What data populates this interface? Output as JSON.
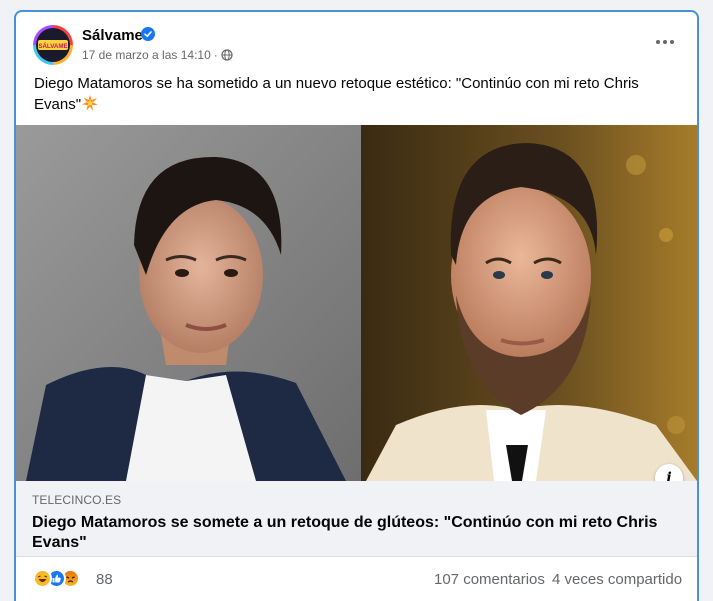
{
  "post": {
    "page_name": "Sálvame",
    "avatar_text": "SÁLVAME",
    "timestamp": "17 de marzo a las 14:10",
    "separator": "·",
    "text": "Diego Matamoros se ha sometido a un nuevo retoque estético: \"Continúo con mi reto Chris Evans\""
  },
  "link": {
    "domain": "TELECINCO.ES",
    "title": "Diego Matamoros se somete a un retoque de glúteos: \"Continúo con mi reto Chris Evans\""
  },
  "stats": {
    "reaction_count": "88",
    "comments": "107 comentarios",
    "shares": "4 veces compartido"
  },
  "icons": {
    "verified": "verified-badge-icon",
    "privacy": "globe-icon",
    "more": "more-options-icon",
    "burst": "collision-emoji-icon",
    "info": "info-icon",
    "reactions": [
      "haha-reaction-icon",
      "like-reaction-icon",
      "angry-reaction-icon"
    ]
  },
  "colors": {
    "accent": "#1877f2",
    "card_border": "#4a90d9",
    "secondary_text": "#65676b"
  }
}
